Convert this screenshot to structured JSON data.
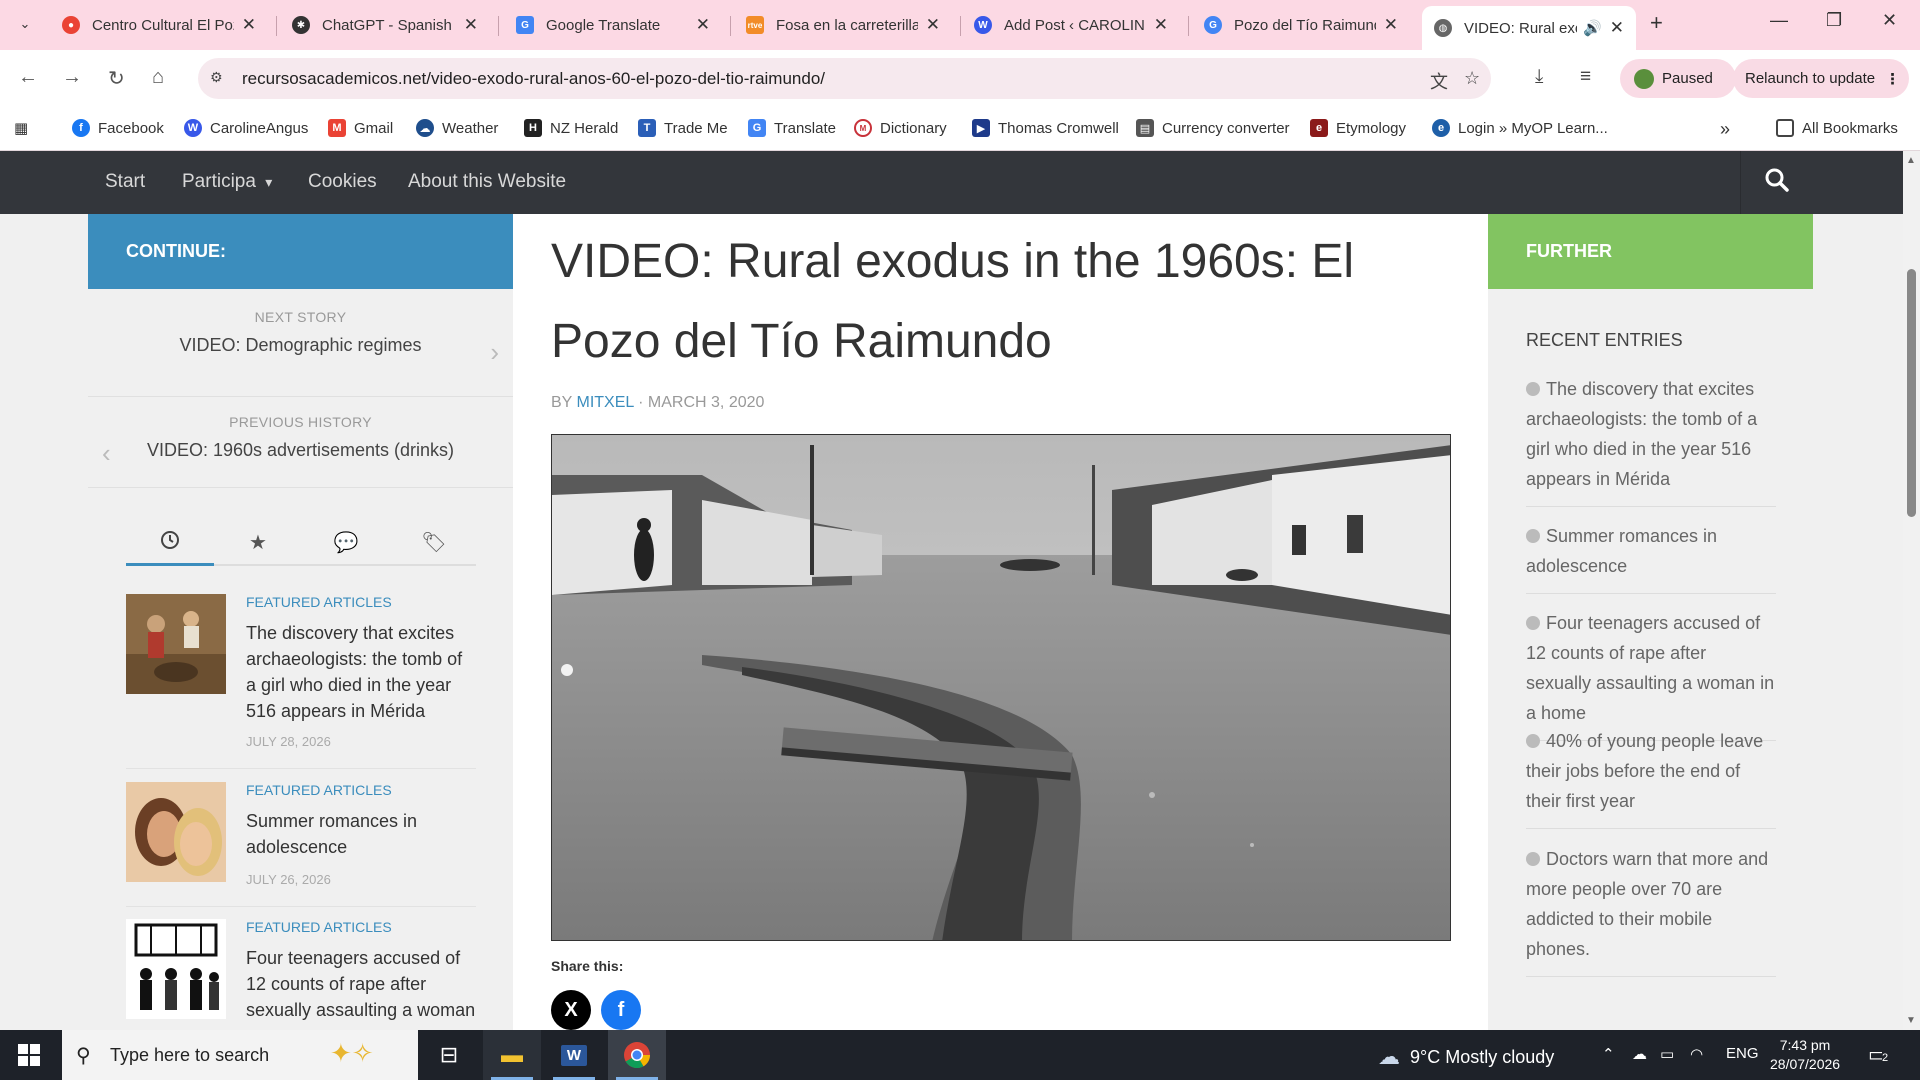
{
  "browser": {
    "tabs": [
      {
        "title": "Centro Cultural El Pozo",
        "icon": "maps-pin-icon",
        "color": "#ea4335"
      },
      {
        "title": "ChatGPT - Spanish Ch",
        "icon": "chatgpt-icon",
        "color": "#333333"
      },
      {
        "title": "Google Translate",
        "icon": "translate-icon",
        "color": "#4285f4"
      },
      {
        "title": "Fosa en la carreterilla",
        "icon": "rtve-icon",
        "color": "#f28c28"
      },
      {
        "title": "Add Post ‹ CAROLINE",
        "icon": "wordpress-icon",
        "color": "#3858e9"
      },
      {
        "title": "Pozo del Tío Raimundo",
        "icon": "google-icon",
        "color": "#4285f4"
      },
      {
        "title": "VIDEO: Rural exo",
        "icon": "globe-icon",
        "color": "#555555"
      }
    ],
    "url": "recursosacademicos.net/video-exodo-rural-anos-60-el-pozo-del-tio-raimundo/",
    "paused_label": "Paused",
    "relaunch_label": "Relaunch to update",
    "bookmarks": [
      {
        "label": "Facebook",
        "color": "#1877f2",
        "glyph": "f"
      },
      {
        "label": "CarolineAngus",
        "color": "#3858e9",
        "glyph": "W"
      },
      {
        "label": "Gmail",
        "color": "#ea4335",
        "glyph": "M"
      },
      {
        "label": "Weather",
        "color": "#1f4e8c",
        "glyph": "☁"
      },
      {
        "label": "NZ Herald",
        "color": "#222222",
        "glyph": "H"
      },
      {
        "label": "Trade Me",
        "color": "#2b5fb8",
        "glyph": "T"
      },
      {
        "label": "Translate",
        "color": "#4285f4",
        "glyph": "G"
      },
      {
        "label": "Dictionary",
        "color": "#c8323a",
        "glyph": "M"
      },
      {
        "label": "Thomas Cromwell",
        "color": "#1e3a8a",
        "glyph": "▶"
      },
      {
        "label": "Currency converter",
        "color": "#555555",
        "glyph": "▤"
      },
      {
        "label": "Etymology",
        "color": "#8b1a1a",
        "glyph": "e"
      },
      {
        "label": "Login » MyOP Learn...",
        "color": "#1e5fa8",
        "glyph": "e"
      }
    ],
    "all_bookmarks": "All Bookmarks",
    "overflow": "»"
  },
  "site": {
    "nav": [
      "Start",
      "Participa",
      "Cookies",
      "About this Website"
    ],
    "nav_dropdown": "▾",
    "left": {
      "header": "CONTINUE:",
      "next_label": "NEXT STORY",
      "next_title": "VIDEO: Demographic regimes",
      "prev_label": "PREVIOUS HISTORY",
      "prev_title": "VIDEO: 1960s advertisements (drinks)",
      "featured": [
        {
          "category": "FEATURED ARTICLES",
          "title": "The discovery that excites archaeologists: the tomb of a girl who died in the year 516 appears in Mérida",
          "date": "JULY 28, 2026"
        },
        {
          "category": "FEATURED ARTICLES",
          "title": "Summer romances in adolescence",
          "date": "JULY 26, 2026"
        },
        {
          "category": "FEATURED ARTICLES",
          "title": "Four teenagers accused of 12 counts of rape after sexually assaulting a woman",
          "date": ""
        }
      ]
    },
    "article": {
      "title": "VIDEO: Rural exodus in the 1960s: El Pozo del Tío Raimundo",
      "by": "BY ",
      "author": "MITXEL",
      "date": " · MARCH 3, 2020",
      "share_label": "Share this:",
      "share_x": "X",
      "share_fb": "f"
    },
    "right": {
      "header": "FURTHER",
      "recent_label": "RECENT ENTRIES",
      "recent": [
        "The discovery that excites archaeologists: the tomb of a girl who died in the year 516 appears in Mérida",
        "Summer romances in adolescence",
        "Four teenagers accused of 12 counts of rape after sexually assaulting a woman in a home",
        "40% of young people leave their jobs before the end of their first year",
        "Doctors warn that more and more people over 70 are addicted to their mobile phones."
      ]
    }
  },
  "taskbar": {
    "search_placeholder": "Type here to search",
    "weather": "9°C  Mostly cloudy",
    "lang": "ENG",
    "time": "7:43 pm",
    "date": "28/07/2026",
    "notifications": "2"
  }
}
